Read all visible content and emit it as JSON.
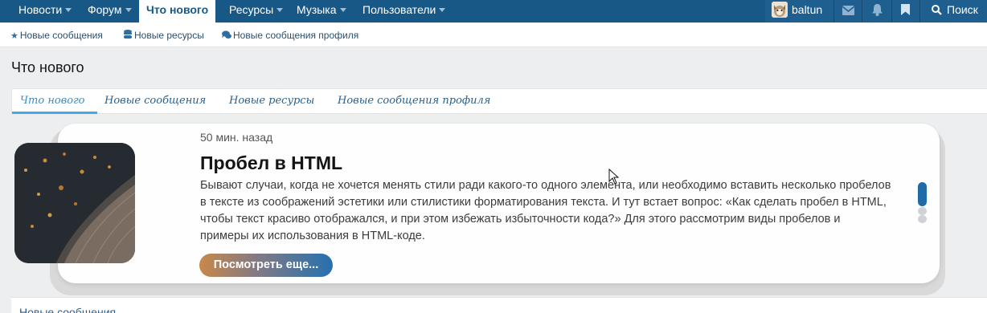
{
  "topnav": {
    "items": [
      {
        "label": "Новости",
        "dropdown": true
      },
      {
        "label": "Форум",
        "dropdown": true
      },
      {
        "label": "Что нового",
        "dropdown": false,
        "active": true
      },
      {
        "label": "Ресурсы",
        "dropdown": true
      },
      {
        "label": "Музыка",
        "dropdown": true
      },
      {
        "label": "Пользователи",
        "dropdown": true
      }
    ],
    "username": "baltun",
    "search_label": "Поиск",
    "right_icons": [
      "envelope-icon",
      "bell-icon",
      "bookmark-icon",
      "search-icon"
    ]
  },
  "subnav": {
    "items": [
      {
        "label": "Новые сообщения",
        "icon": "star-icon"
      },
      {
        "label": "Новые ресурсы",
        "icon": "database-icon"
      },
      {
        "label": "Новые сообщения профиля",
        "icon": "comments-icon"
      }
    ]
  },
  "page": {
    "title": "Что нового"
  },
  "tabs": [
    {
      "label": "Что нового",
      "active": true
    },
    {
      "label": "Новые сообщения",
      "active": false
    },
    {
      "label": "Новые ресурсы",
      "active": false
    },
    {
      "label": "Новые сообщения профиля",
      "active": false
    }
  ],
  "card": {
    "time": "50 мин. назад",
    "title": "Пробел в HTML",
    "text": "Бывают случаи, когда не хочется менять стили ради какого-то одного элемента, или необходимо вставить несколько пробелов в тексте из соображений эстетики или стилистики форматирования текста. И тут встает вопрос: «Как сделать пробел в HTML, чтобы текст красиво отображался, и при этом избежать избыточности кода?» Для этого рассмотрим виды пробелов и примеры их использования в HTML-коде.",
    "button_label": "Посмотреть еще...",
    "slides_count": 3,
    "active_slide": 0
  },
  "bottom": {
    "label": "Новые сообщения"
  },
  "colors": {
    "nav_bg": "#185886",
    "accent": "#47a7eb",
    "link": "#2c5f8a",
    "button_start": "#c88849",
    "button_end": "#2670b0"
  }
}
